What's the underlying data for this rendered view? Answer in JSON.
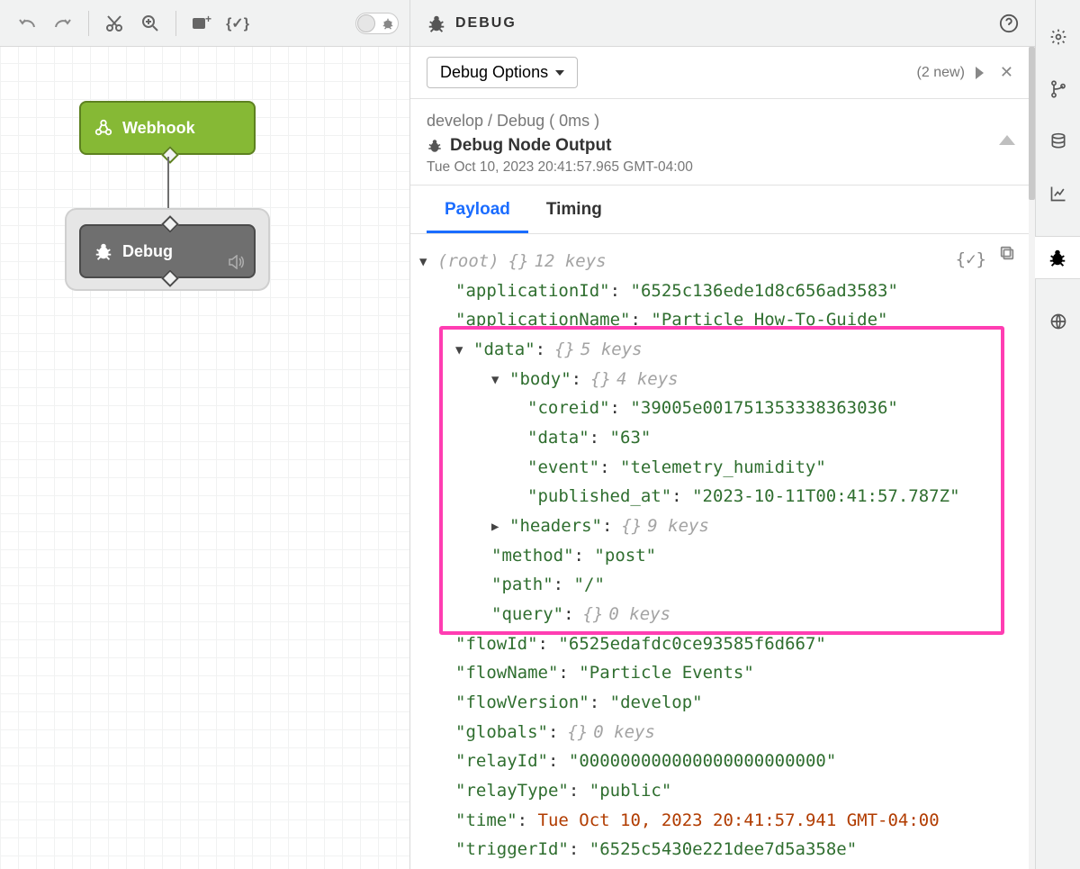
{
  "toolbar": {
    "undo": "undo",
    "redo": "redo",
    "cut": "cut",
    "search": "search",
    "add_node": "add-node",
    "code": "code",
    "debug_toggle": "debug-toggle"
  },
  "canvas": {
    "webhook_label": "Webhook",
    "debug_label": "Debug"
  },
  "panel": {
    "title": "DEBUG",
    "options_label": "Debug Options",
    "new_count": "(2 new)",
    "breadcrumb": "develop / Debug ( 0ms )",
    "node_output": "Debug Node Output",
    "timestamp": "Tue Oct 10, 2023 20:41:57.965 GMT-04:00",
    "tabs": {
      "payload": "Payload",
      "timing": "Timing"
    }
  },
  "payload": {
    "root_label": "(root)",
    "root_keys": "12 keys",
    "applicationId": "6525c136ede1d8c656ad3583",
    "applicationName": "Particle How-To-Guide",
    "data_keys": "5 keys",
    "body_keys": "4 keys",
    "coreid": "39005e001751353338363036",
    "data": "63",
    "event": "telemetry_humidity",
    "published_at": "2023-10-11T00:41:57.787Z",
    "headers_keys": "9 keys",
    "method": "post",
    "path": "/",
    "query_keys": "0 keys",
    "flowId": "6525edafdc0ce93585f6d667",
    "flowName": "Particle Events",
    "flowVersion": "develop",
    "globals_keys": "0 keys",
    "relayId": "000000000000000000000000",
    "relayType": "public",
    "time": "Tue Oct 10, 2023 20:41:57.941 GMT-04:00",
    "triggerId": "6525c5430e221dee7d5a358e"
  }
}
